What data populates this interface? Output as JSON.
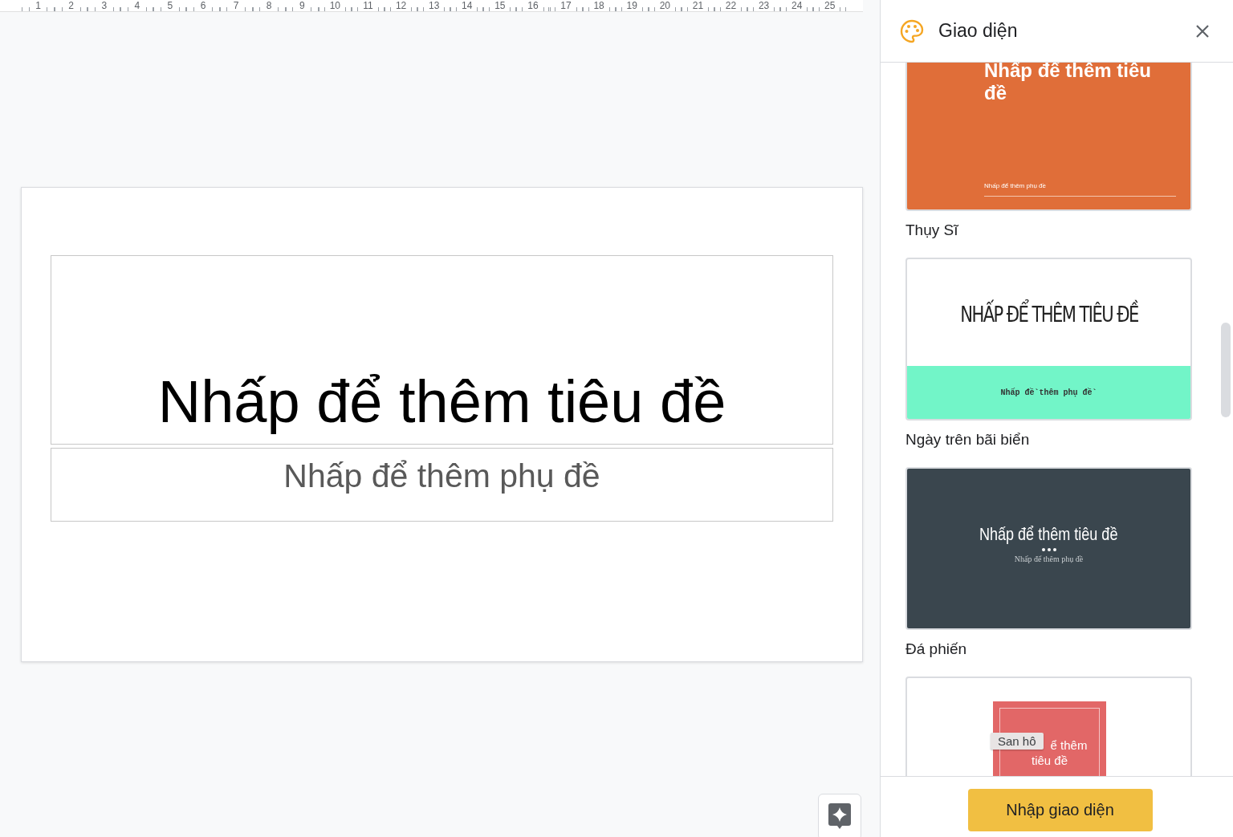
{
  "ruler": {
    "marks": [
      "1",
      "2",
      "3",
      "4",
      "5",
      "6",
      "7",
      "8",
      "9",
      "10",
      "11",
      "12",
      "13",
      "14",
      "15",
      "16",
      "17",
      "18",
      "19",
      "20",
      "21",
      "22",
      "23",
      "24",
      "25"
    ]
  },
  "slide": {
    "title_placeholder": "Nhấp để thêm tiêu đề",
    "subtitle_placeholder": "Nhấp để thêm phụ đề"
  },
  "panel": {
    "title": "Giao diện",
    "themes": [
      {
        "kind": "swiss",
        "title": "Nhấp để thêm tiêu đề",
        "subtitle": "Nhấp để thêm phụ đề",
        "name": "Thụy Sĩ"
      },
      {
        "kind": "beach",
        "title": "NHẤP ĐỂ THÊM TIÊU ĐỀ",
        "subtitle": "Nhấp đề`thêm phụ đề`",
        "name": "Ngày trên bãi biển"
      },
      {
        "kind": "slate",
        "title": "Nhấp để thêm tiêu đề",
        "subtitle": "Nhấp để thêm phụ đề",
        "name": "Đá phiến"
      },
      {
        "kind": "coral",
        "title_lines": [
          "ể thêm",
          "tiêu đề"
        ],
        "tooltip": "San hô"
      }
    ],
    "import_button": "Nhập giao diện"
  }
}
